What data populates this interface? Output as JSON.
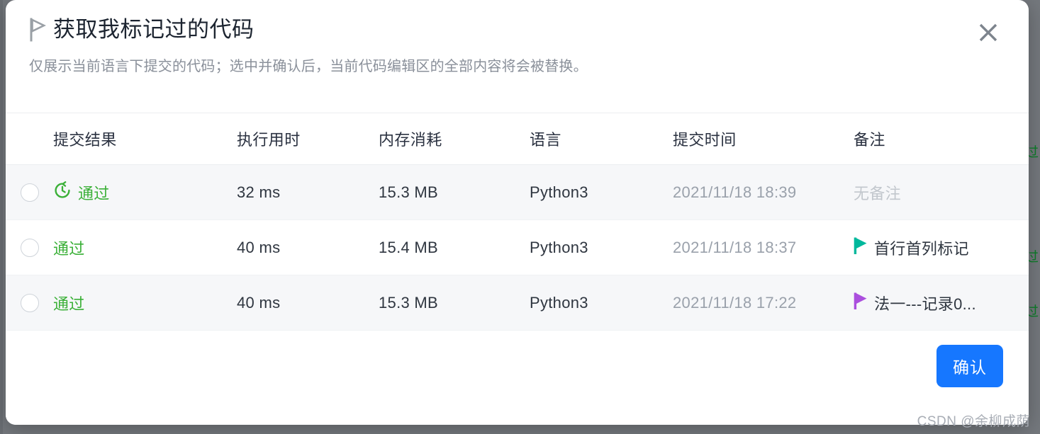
{
  "backdrop": {
    "fragments": [
      "通过",
      "通过",
      "通过"
    ]
  },
  "dialog": {
    "title": "获取我标记过的代码",
    "title_icon": "flag-outline-icon",
    "subtitle": "仅展示当前语言下提交的代码；选中并确认后，当前代码编辑区的全部内容将会被替换。",
    "close_icon": "close-icon",
    "accent_color": "#1677ff"
  },
  "table": {
    "columns": [
      {
        "key": "select",
        "label": ""
      },
      {
        "key": "result",
        "label": "提交结果"
      },
      {
        "key": "runtime",
        "label": "执行用时"
      },
      {
        "key": "memory",
        "label": "内存消耗"
      },
      {
        "key": "language",
        "label": "语言"
      },
      {
        "key": "submitted_at",
        "label": "提交时间"
      },
      {
        "key": "note",
        "label": "备注"
      }
    ],
    "rows": [
      {
        "selected": false,
        "result": "通过",
        "result_color": "#3bb038",
        "result_icon": "history-clock-icon",
        "result_icon_color": "#3bb038",
        "runtime": "32 ms",
        "memory": "15.3 MB",
        "language": "Python3",
        "submitted_at": "2021/11/18 18:39",
        "note": "无备注",
        "note_is_placeholder": true,
        "note_flag_color": ""
      },
      {
        "selected": false,
        "result": "通过",
        "result_color": "#3bb038",
        "result_icon": "",
        "result_icon_color": "",
        "runtime": "40 ms",
        "memory": "15.4 MB",
        "language": "Python3",
        "submitted_at": "2021/11/18 18:37",
        "note": "首行首列标记",
        "note_is_placeholder": false,
        "note_flag_color": "#00b89c"
      },
      {
        "selected": false,
        "result": "通过",
        "result_color": "#3bb038",
        "result_icon": "",
        "result_icon_color": "",
        "runtime": "40 ms",
        "memory": "15.3 MB",
        "language": "Python3",
        "submitted_at": "2021/11/18 17:22",
        "note": "法一---记录0...",
        "note_is_placeholder": false,
        "note_flag_color": "#ab4fde"
      }
    ]
  },
  "footer": {
    "confirm_label": "确认"
  },
  "watermark": {
    "text": "CSDN @余柳成荫"
  }
}
